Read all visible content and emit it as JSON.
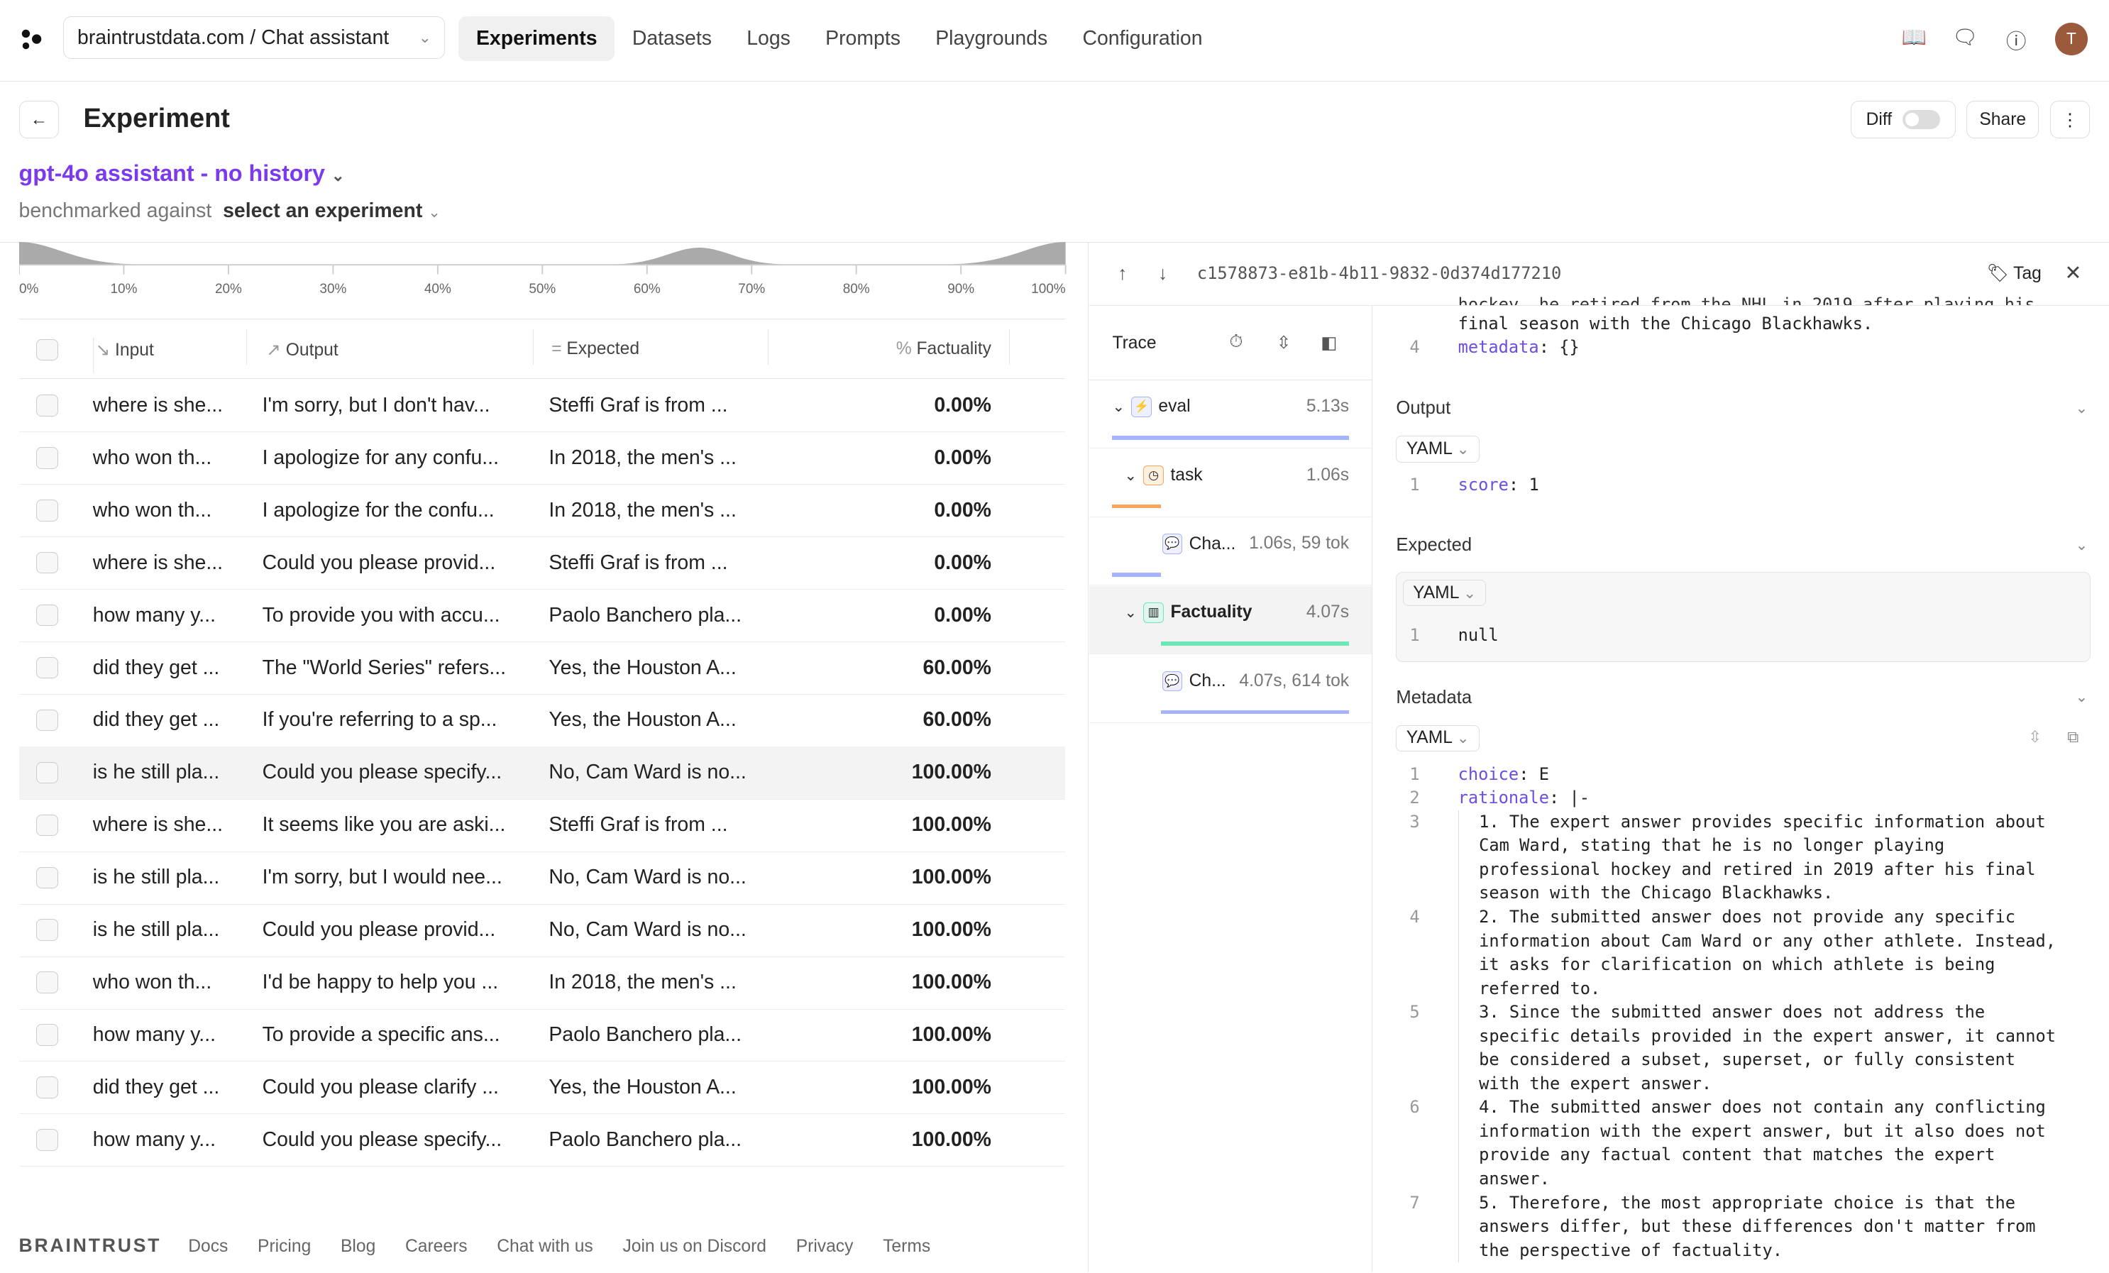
{
  "topbar": {
    "project": "braintrustdata.com / Chat assistant",
    "nav": [
      "Experiments",
      "Datasets",
      "Logs",
      "Prompts",
      "Playgrounds",
      "Configuration"
    ],
    "active": "Experiments",
    "avatar": "T"
  },
  "header": {
    "title": "Experiment",
    "experiment": "gpt-4o assistant - no history",
    "benchmark_label": "benchmarked against",
    "benchmark_value": "select an experiment",
    "diff": "Diff",
    "diff_on": false,
    "share": "Share"
  },
  "distribution": {
    "ticks": [
      "0%",
      "10%",
      "20%",
      "30%",
      "40%",
      "50%",
      "60%",
      "70%",
      "80%",
      "90%",
      "100%"
    ],
    "peaks": [
      0,
      65,
      100
    ]
  },
  "table": {
    "columns": [
      "Input",
      "Output",
      "Expected",
      "Factuality"
    ],
    "rows": [
      [
        "where is she...",
        "I'm sorry, but I don't hav...",
        "Steffi Graf is from ...",
        "0.00%"
      ],
      [
        "who won th...",
        "I apologize for any confu...",
        "In 2018, the men's ...",
        "0.00%"
      ],
      [
        "who won th...",
        "I apologize for the confu...",
        "In 2018, the men's ...",
        "0.00%"
      ],
      [
        "where is she...",
        "Could you please provid...",
        "Steffi Graf is from ...",
        "0.00%"
      ],
      [
        "how many y...",
        "To provide you with accu...",
        "Paolo Banchero pla...",
        "0.00%"
      ],
      [
        "did they get ...",
        "The \"World Series\" refers...",
        "Yes, the Houston A...",
        "60.00%"
      ],
      [
        "did they get ...",
        "If you're referring to a sp...",
        "Yes, the Houston A...",
        "60.00%"
      ],
      [
        "is he still pla...",
        "Could you please specify...",
        "No, Cam Ward is no...",
        "100.00%"
      ],
      [
        "where is she...",
        "It seems like you are aski...",
        "Steffi Graf is from ...",
        "100.00%"
      ],
      [
        "is he still pla...",
        "I'm sorry, but I would nee...",
        "No, Cam Ward is no...",
        "100.00%"
      ],
      [
        "is he still pla...",
        "Could you please provid...",
        "No, Cam Ward is no...",
        "100.00%"
      ],
      [
        "who won th...",
        "I'd be happy to help you ...",
        "In 2018, the men's ...",
        "100.00%"
      ],
      [
        "how many y...",
        "To provide a specific ans...",
        "Paolo Banchero pla...",
        "100.00%"
      ],
      [
        "did they get ...",
        "Could you please clarify ...",
        "Yes, the Houston A...",
        "100.00%"
      ],
      [
        "how many y...",
        "Could you please specify...",
        "Paolo Banchero pla...",
        "100.00%"
      ]
    ],
    "highlighted_row": 7
  },
  "footer": {
    "brand": "BRAINTRUST",
    "links": [
      "Docs",
      "Pricing",
      "Blog",
      "Careers",
      "Chat with us",
      "Join us on Discord",
      "Privacy",
      "Terms"
    ]
  },
  "panel": {
    "id": "c1578873-e81b-4b11-9832-0d374d177210",
    "tag": "Tag",
    "trace": "Trace",
    "spans": [
      {
        "name": "eval",
        "time": "5.13s"
      },
      {
        "name": "task",
        "time": "1.06s"
      },
      {
        "name": "Cha...",
        "time": "1.06s, 59 tok"
      },
      {
        "name": "Factuality",
        "time": "4.07s"
      },
      {
        "name": "Ch...",
        "time": "4.07s, 614 tok"
      }
    ],
    "input_tail": "final season with the Chicago Blackhawks.",
    "input_line4_key": "metadata",
    "input_line4_val": ": {}",
    "output": {
      "label": "Output",
      "format": "YAML",
      "key": "score",
      "val": ": 1"
    },
    "expected": {
      "label": "Expected",
      "format": "YAML",
      "val": "null"
    },
    "metadata": {
      "label": "Metadata",
      "format": "YAML",
      "lines": [
        {
          "n": "1",
          "text": "",
          "key": "choice",
          "val": ": E"
        },
        {
          "n": "2",
          "text": "",
          "key": "rationale",
          "val": ": |-"
        },
        {
          "n": "3",
          "text": "  1. The expert answer provides specific information about\n  Cam Ward, stating that he is no longer playing\n  professional hockey and retired in 2019 after his final\n  season with the Chicago Blackhawks."
        },
        {
          "n": "4",
          "text": "  2. The submitted answer does not provide any specific\n  information about Cam Ward or any other athlete. Instead,\n  it asks for clarification on which athlete is being\n  referred to."
        },
        {
          "n": "5",
          "text": "  3. Since the submitted answer does not address the\n  specific details provided in the expert answer, it cannot\n  be considered a subset, superset, or fully consistent\n  with the expert answer."
        },
        {
          "n": "6",
          "text": "  4. The submitted answer does not contain any conflicting\n  information with the expert answer, but it also does not\n  provide any factual content that matches the expert\n  answer."
        },
        {
          "n": "7",
          "text": "  5. Therefore, the most appropriate choice is that the\n  answers differ, but these differences don't matter from\n  the perspective of factuality."
        }
      ]
    }
  },
  "colors": {
    "accent": "#7c3aed",
    "eval": "#a5b4fc",
    "task": "#f5a55c",
    "llm": "#a5b4fc",
    "score": "#6ee7b7"
  }
}
